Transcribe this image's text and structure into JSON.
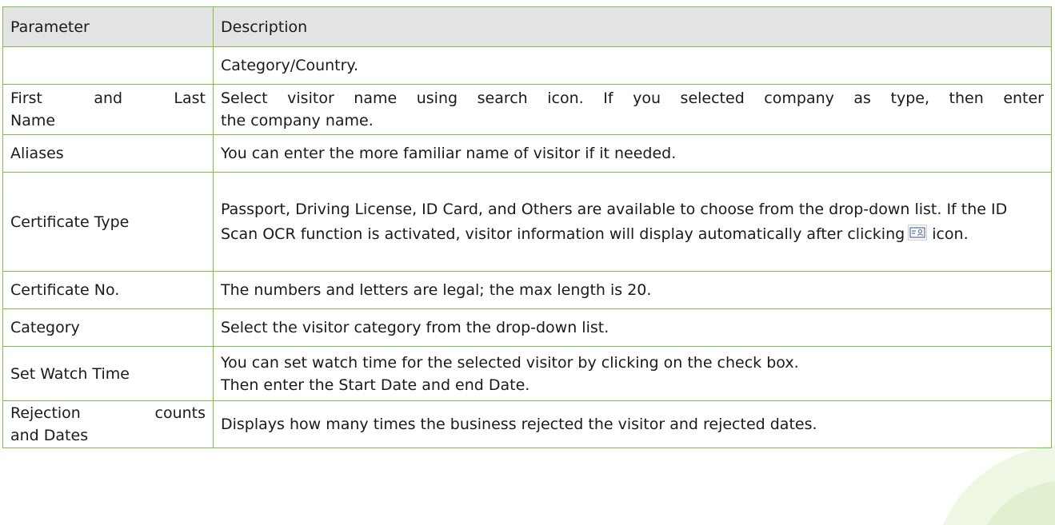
{
  "table": {
    "headers": {
      "parameter": "Parameter",
      "description": "Description"
    },
    "rows": [
      {
        "parameter": "",
        "description": "Category/Country."
      },
      {
        "parameter": "First and Last Name",
        "parameter_line1": "First and Last",
        "parameter_line2": "Name",
        "description": "Select visitor name using search icon. If you selected company as type, then enter the company name.",
        "description_line1": "Select visitor name using search icon. If you selected company as type, then enter",
        "description_line2": "the company name."
      },
      {
        "parameter": "Aliases",
        "description": "You can enter the more familiar name of visitor if it needed."
      },
      {
        "parameter": "Certificate Type",
        "description_before_icon": "Passport, Driving License, ID Card, and Others are available to choose from the drop-down list. If the ID Scan OCR function is activated, visitor information will display automatically after clicking",
        "description_after_icon": "icon.",
        "description_icon": "id-scan-icon"
      },
      {
        "parameter": "Certificate No.",
        "description": "The numbers and letters are legal; the max length is 20."
      },
      {
        "parameter": "Category",
        "description": "Select the visitor category from the drop-down list."
      },
      {
        "parameter": "Set Watch Time",
        "description_line1": "You can set watch time for the selected visitor by clicking on the check box.",
        "description_line2": "Then enter the Start Date and end Date."
      },
      {
        "parameter": "Rejection counts and Dates",
        "parameter_line1": "Rejection counts",
        "parameter_line2": "and Dates",
        "description": "Displays how many times the business rejected the visitor and rejected dates."
      }
    ]
  },
  "colors": {
    "border": "#7fc241",
    "header_bg": "#e3e3e3",
    "text": "#1a1a1a",
    "watermark": "#d9ecc4"
  }
}
